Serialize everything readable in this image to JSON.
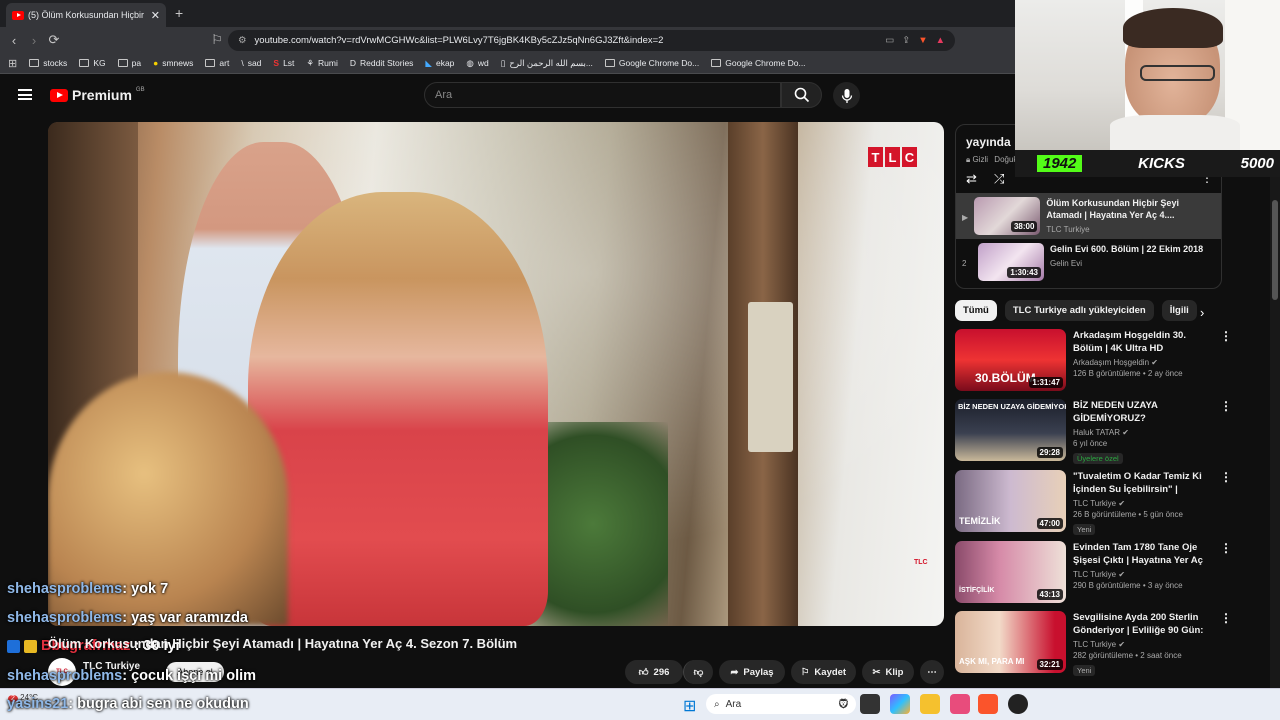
{
  "browser": {
    "tab_title": "(5) Ölüm Korkusundan Hiçbir",
    "tab_close": "✕",
    "new_tab": "+",
    "url": "youtube.com/watch?v=rdVrwMCGHWc&list=PLW6Lvy7T6jgBK4KBy5cZJz5qNn6GJ3Zft&index=2",
    "bookmarks": [
      "stocks",
      "KG",
      "pa",
      "smnews",
      "art",
      "sad",
      "Lst",
      "Rumi",
      "Reddit Stories",
      "ekap",
      "wd",
      "بسم الله الرحمن الرح...",
      "Google Chrome Do...",
      "Google Chrome Do..."
    ]
  },
  "youtube": {
    "logo": "Premium",
    "logo_region": "GB",
    "search_placeholder": "Ara"
  },
  "video": {
    "title": "Ölüm Korkusundan Hiçbir Şeyi Atamadı | Hayatına Yer Aç 4. Sezon 7. Bölüm",
    "channel": "TLC Turkiye",
    "channel_avatar": "TLC",
    "subscribe": "Abone ol",
    "likes": "296",
    "share": "Paylaş",
    "save": "Kaydet",
    "clip": "Klip",
    "tlc_letters": [
      "T",
      "L",
      "C"
    ],
    "tlc_small": "TLC"
  },
  "chat": [
    {
      "user": "shehasproblems",
      "msg": ": yok 7"
    },
    {
      "user": "shehasproblems",
      "msg": ": yaş var aramızda"
    },
    {
      "user": "Bbugrafrmaz",
      "msg": ": 30 iyi"
    },
    {
      "user": "shehasproblems",
      "msg": ": çocuk işçi mi olim"
    },
    {
      "user": "yasins21",
      "msg": ": bugra abi sen ne okudun"
    }
  ],
  "playlist": {
    "title": "yayında",
    "visibility": "Gizli",
    "owner": "Doğukan",
    "items": [
      {
        "num": "▶",
        "title": "Ölüm Korkusundan Hiçbir Şeyi Atamadı | Hayatına Yer Aç 4....",
        "channel": "TLC Turkiye",
        "duration": "38:00"
      },
      {
        "num": "2",
        "title": "Gelin Evi 600. Bölüm | 22 Ekim 2018",
        "channel": "Gelin Evi",
        "duration": "1:30:43"
      }
    ]
  },
  "chips": [
    "Tümü",
    "TLC Turkiye adlı yükleyiciden",
    "İlgili"
  ],
  "recommendations": [
    {
      "title": "Arkadaşım Hoşgeldin 30. Bölüm | 4K Ultra HD",
      "channel": "Arkadaşım Hoşgeldin",
      "views": "126 B görüntüleme • 2 ay önce",
      "duration": "1:31:47",
      "badge": "",
      "thumb_text": "30.BÖLÜM"
    },
    {
      "title": "BİZ NEDEN UZAYA GİDEMİYORUZ?",
      "channel": "Haluk TATAR",
      "views": "6 yıl önce",
      "duration": "29:28",
      "badge": "Üyelere özel",
      "thumb_text": "BİZ NEDEN UZAYA GİDEMİYORUZ?"
    },
    {
      "title": "\"Tuvaletim O Kadar Temiz Ki İçinden Su İçebilirsin\" | Temizli...",
      "channel": "TLC Turkiye",
      "views": "26 B görüntüleme • 5 gün önce",
      "duration": "47:00",
      "badge": "Yeni",
      "thumb_text": "TEMİZLİK"
    },
    {
      "title": "Evinden Tam 1780 Tane Oje Şişesi Çıktı | Hayatına Yer Aç 2...",
      "channel": "TLC Turkiye",
      "views": "290 B görüntüleme • 3 ay önce",
      "duration": "43:13",
      "badge": "",
      "thumb_text": "İSTİFÇİLİK"
    },
    {
      "title": "Sevgilisine Ayda 200 Sterlin Gönderiyor | Evliliğe 90 Gün: ...",
      "channel": "TLC Turkiye",
      "views": "282 görüntüleme • 2 saat önce",
      "duration": "32:21",
      "badge": "Yeni",
      "thumb_text": "AŞK MI, PARA MI"
    }
  ],
  "overlay": {
    "kicks_left": "1942",
    "kicks_label": "KICKS",
    "kicks_right": "5000"
  },
  "taskbar": {
    "search": "Ara",
    "weather": "24°C",
    "notif": "2"
  },
  "colors": {
    "yt_red": "#ff0000",
    "tlc_red": "#d4152a",
    "kicks_green": "#53fc18",
    "username_blue": "#8fb8e8"
  }
}
